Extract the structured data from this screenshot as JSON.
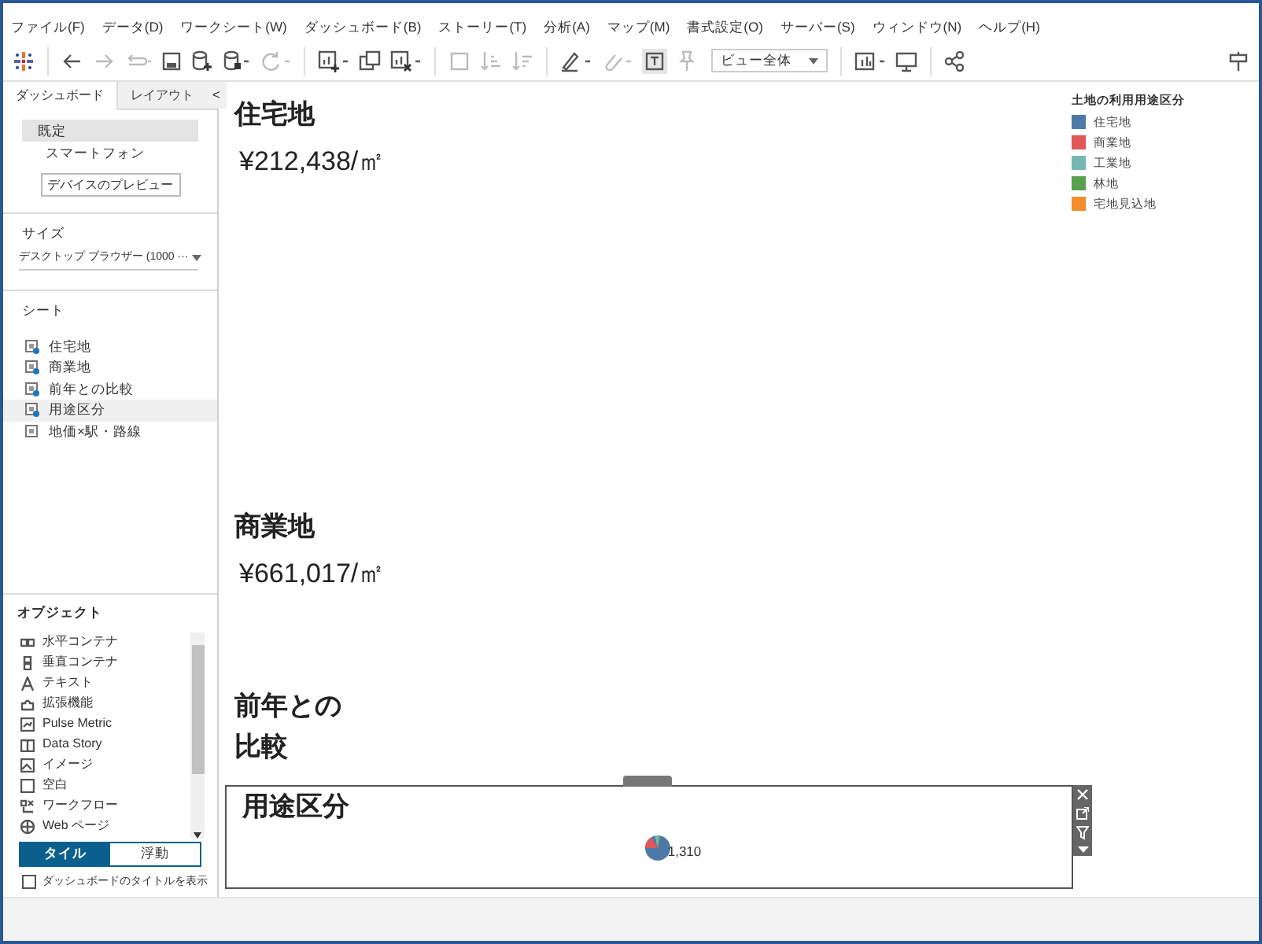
{
  "menu": [
    "ファイル(F)",
    "データ(D)",
    "ワークシート(W)",
    "ダッシュボード(B)",
    "ストーリー(T)",
    "分析(A)",
    "マップ(M)",
    "書式設定(O)",
    "サーバー(S)",
    "ウィンドウ(N)",
    "ヘルプ(H)"
  ],
  "toolbar": {
    "fit": "ビュー全体"
  },
  "side_tabs": [
    {
      "label": "ダッシュボード",
      "selected": true
    },
    {
      "label": "レイアウト",
      "selected": false
    }
  ],
  "collapse": "<",
  "devices": [
    {
      "label": "既定",
      "selected": true
    },
    {
      "label": "スマートフォン",
      "selected": false
    }
  ],
  "device_preview": "デバイスのプレビュー",
  "size": {
    "heading": "サイズ",
    "value": "デスクトップ ブラウザー (1000 ···"
  },
  "sheets": {
    "heading": "シート",
    "items": [
      {
        "label": "住宅地",
        "in_use": true,
        "selected": false
      },
      {
        "label": "商業地",
        "in_use": true,
        "selected": false
      },
      {
        "label": "前年との比較",
        "in_use": true,
        "selected": false
      },
      {
        "label": "用途区分",
        "in_use": true,
        "selected": true
      },
      {
        "label": "地価×駅・路線",
        "in_use": false,
        "selected": false
      }
    ]
  },
  "objects": {
    "heading": "オブジェクト",
    "items": [
      {
        "kind": "hcontainer",
        "label": "水平コンテナ"
      },
      {
        "kind": "vcontainer",
        "label": "垂直コンテナ"
      },
      {
        "kind": "text",
        "label": "テキスト"
      },
      {
        "kind": "extension",
        "label": "拡張機能"
      },
      {
        "kind": "pulse",
        "label": "Pulse Metric"
      },
      {
        "kind": "story",
        "label": "Data Story"
      },
      {
        "kind": "image",
        "label": "イメージ"
      },
      {
        "kind": "blank",
        "label": "空白"
      },
      {
        "kind": "workflow",
        "label": "ワークフロー"
      },
      {
        "kind": "web",
        "label": "Web ページ"
      }
    ]
  },
  "layout_mode": [
    {
      "label": "タイル",
      "selected": true
    },
    {
      "label": "浮動",
      "selected": false
    }
  ],
  "show_title": {
    "label": "ダッシュボードのタイトルを表示",
    "checked": false
  },
  "dashboard": {
    "zones": [
      {
        "title": "住宅地",
        "value": "¥212,438/㎡"
      },
      {
        "title": "商業地",
        "value": "¥661,017/㎡"
      },
      {
        "title": "前年との比較"
      },
      {
        "title": "用途区分",
        "selected": true,
        "pie_label": "1,310"
      }
    ],
    "legend": {
      "title": "土地の利用用途区分",
      "items": [
        {
          "label": "住宅地",
          "color": "#4e79a7"
        },
        {
          "label": "商業地",
          "color": "#e15759"
        },
        {
          "label": "工業地",
          "color": "#76b7b2"
        },
        {
          "label": "林地",
          "color": "#59a14f"
        },
        {
          "label": "宅地見込地",
          "color": "#f28e2b"
        }
      ]
    }
  }
}
